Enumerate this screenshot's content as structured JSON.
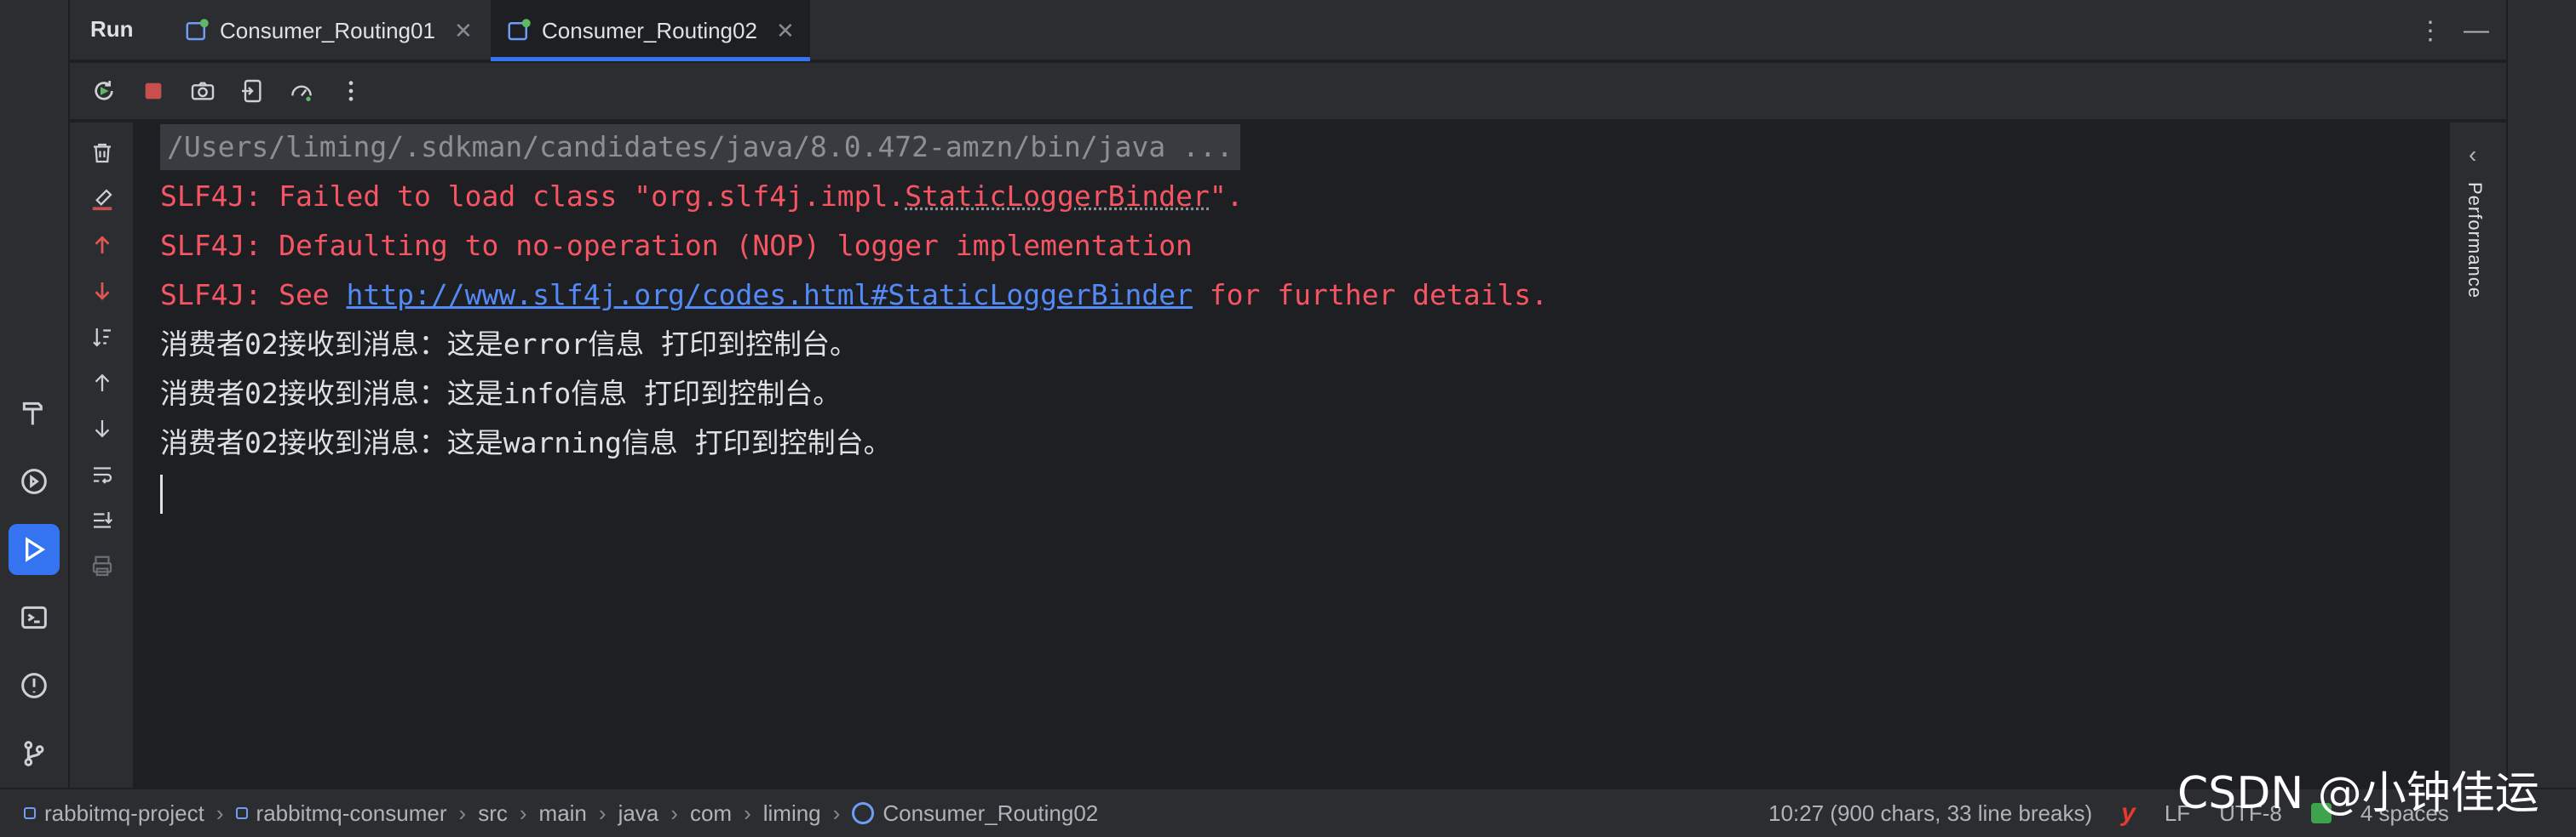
{
  "top_bar": {
    "run_label": "Run",
    "tabs": [
      {
        "label": "Consumer_Routing01",
        "active": false
      },
      {
        "label": "Consumer_Routing02",
        "active": true
      }
    ],
    "more_icon": "⋮",
    "minimize_icon": "—"
  },
  "console": {
    "lines": [
      {
        "kind": "command",
        "text": "/Users/liming/.sdkman/candidates/java/8.0.472-amzn/bin/java ..."
      },
      {
        "kind": "error",
        "prefix": "SLF4J: Failed to load class \"org.slf4j.impl.",
        "squiggle": "StaticLoggerBinder",
        "suffix": "\"."
      },
      {
        "kind": "error",
        "text": "SLF4J: Defaulting to no-operation (NOP) logger implementation"
      },
      {
        "kind": "error",
        "prefix": "SLF4J: See ",
        "link": "http://www.slf4j.org/codes.html#StaticLoggerBinder",
        "suffix": " for further details."
      },
      {
        "kind": "output",
        "text": "消费者02接收到消息：这是error信息 打印到控制台。"
      },
      {
        "kind": "output",
        "text": "消费者02接收到消息：这是info信息 打印到控制台。"
      },
      {
        "kind": "output",
        "text": "消费者02接收到消息：这是warning信息 打印到控制台。"
      }
    ]
  },
  "right_panel": {
    "label": "Performance",
    "chevron": "‹"
  },
  "status_bar": {
    "breadcrumb": [
      "rabbitmq-project",
      "rabbitmq-consumer",
      "src",
      "main",
      "java",
      "com",
      "liming",
      "Consumer_Routing02"
    ],
    "separator": "›",
    "position": "10:27 (900 chars, 33 line breaks)",
    "line_ending": "LF",
    "encoding": "UTF-8",
    "indent": "4 spaces",
    "plugin_mark": "y"
  },
  "watermark": "CSDN @小钟佳运",
  "colors": {
    "accent": "#3574f0",
    "error": "#f75464",
    "link": "#548af7",
    "background": "#1e1f22",
    "panel": "#2b2d30"
  }
}
